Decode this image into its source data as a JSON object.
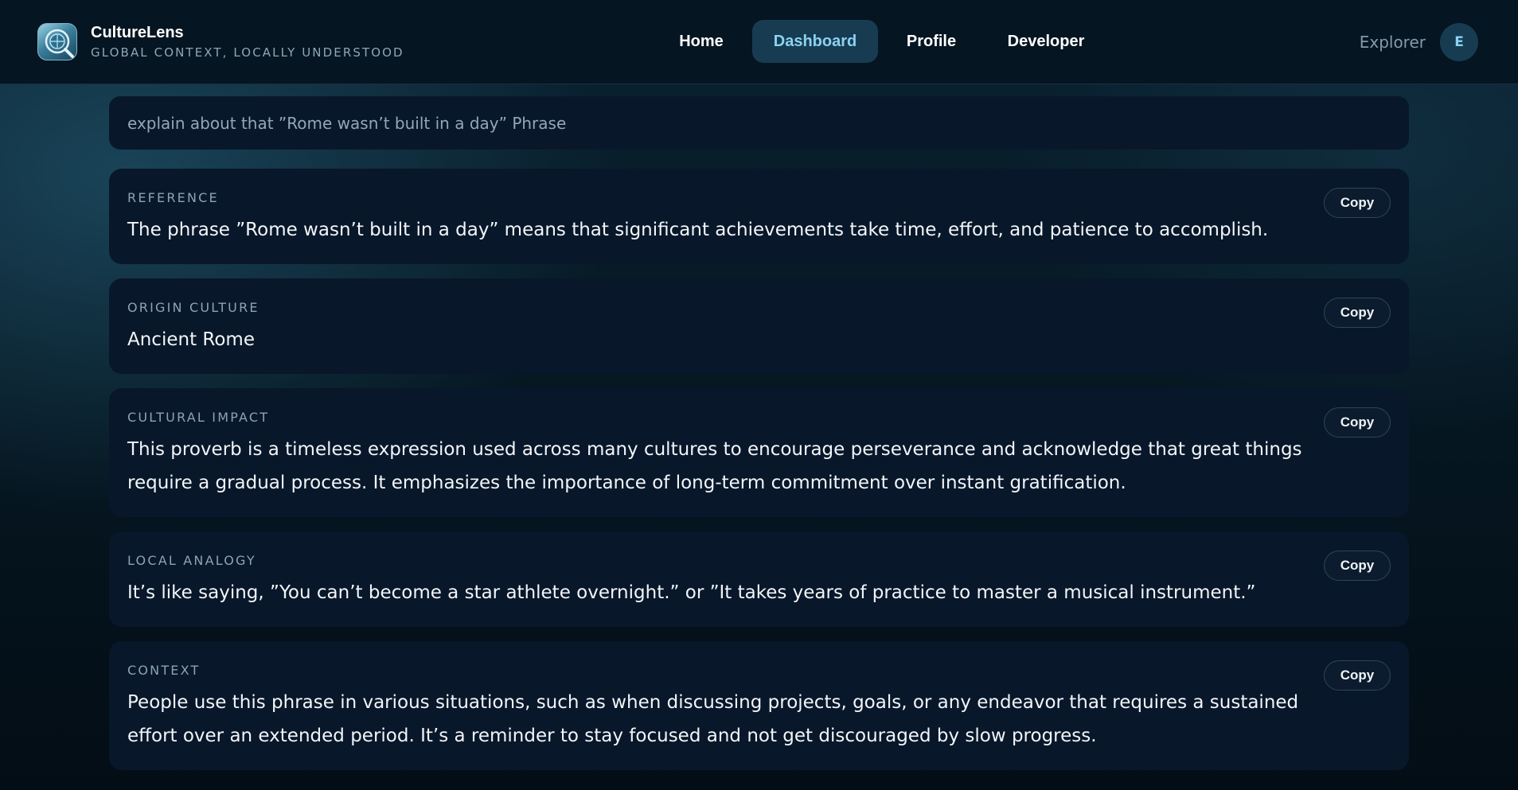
{
  "app": {
    "name": "CultureLens",
    "tagline": "GLOBAL CONTEXT, LOCALLY UNDERSTOOD"
  },
  "nav": {
    "home": "Home",
    "dashboard": "Dashboard",
    "profile": "Profile",
    "developer": "Developer",
    "active": "Dashboard"
  },
  "user": {
    "name": "Explorer",
    "initial": "E"
  },
  "query": {
    "text": "explain about that ”Rome wasn’t built in a day” Phrase"
  },
  "cards": [
    {
      "label": "REFERENCE",
      "text": "The phrase ”Rome wasn’t built in a day” means that significant achievements take time, effort, and patience to accomplish.",
      "copy": "Copy"
    },
    {
      "label": "ORIGIN CULTURE",
      "text": "Ancient Rome",
      "copy": "Copy"
    },
    {
      "label": "CULTURAL IMPACT",
      "text": "This proverb is a timeless expression used across many cultures to encourage perseverance and acknowledge that great things require a gradual process. It emphasizes the importance of long-term commitment over instant gratification.",
      "copy": "Copy"
    },
    {
      "label": "LOCAL ANALOGY",
      "text": "It’s like saying, ”You can’t become a star athlete overnight.” or ”It takes years of practice to master a musical instrument.”",
      "copy": "Copy"
    },
    {
      "label": "CONTEXT",
      "text": "People use this phrase in various situations, such as when discussing projects, goals, or any endeavor that requires a sustained effort over an extended period. It’s a reminder to stay focused and not get discouraged by slow progress.",
      "copy": "Copy"
    }
  ],
  "colors": {
    "accent": "#8cd2f0",
    "active_nav_bg": "#173c52",
    "card_bg": "#08172a"
  },
  "icons": {
    "logo": "globe-magnifier-icon"
  }
}
